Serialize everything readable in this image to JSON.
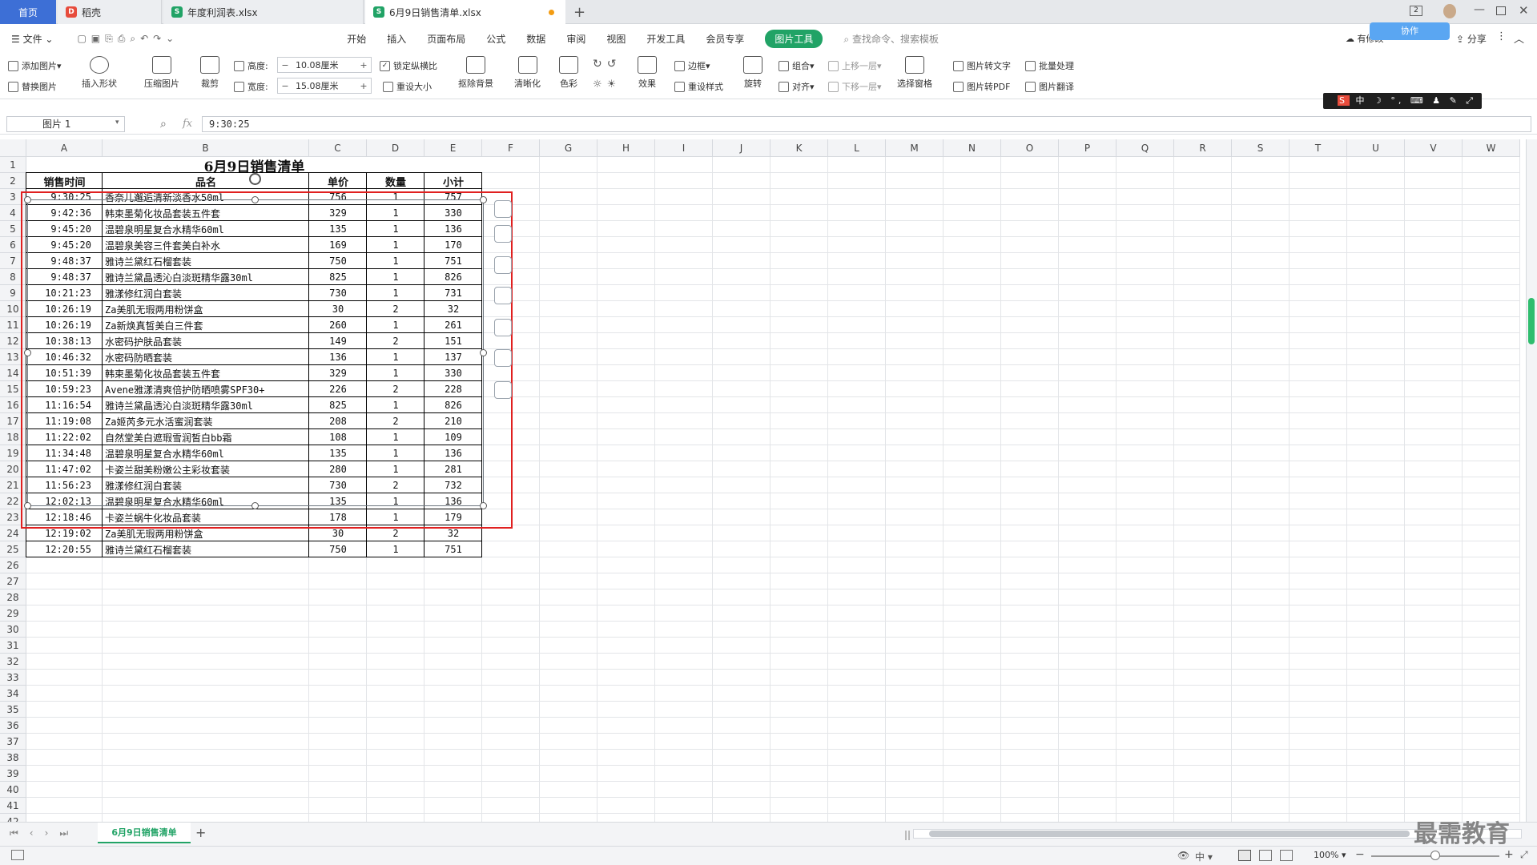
{
  "tabs": [
    {
      "label": "首页"
    },
    {
      "label": "稻壳"
    },
    {
      "label": "年度利润表.xlsx"
    },
    {
      "label": "6月9日销售清单.xlsx"
    }
  ],
  "menu": {
    "file": "文件",
    "items": [
      "开始",
      "插入",
      "页面布局",
      "公式",
      "数据",
      "审阅",
      "视图",
      "开发工具",
      "会员专享",
      "图片工具"
    ],
    "search": "查找命令、搜索模板",
    "share": "分享",
    "collab": "协作",
    "sync": "有修改"
  },
  "ribbon": {
    "add_image": "添加图片",
    "replace_image": "替换图片",
    "insert_shape": "插入形状",
    "compress": "压缩图片",
    "crop": "裁剪",
    "height_label": "高度:",
    "height_value": "10.08厘米",
    "width_label": "宽度:",
    "width_value": "15.08厘米",
    "lock_ratio": "锁定纵横比",
    "reset_size": "重设大小",
    "remove_bg": "抠除背景",
    "sharpen": "清晰化",
    "color": "色彩",
    "effect": "效果",
    "border": "边框",
    "reset_style": "重设样式",
    "rotate": "旋转",
    "group": "组合",
    "align": "对齐",
    "bring_forward": "上移一层",
    "send_backward": "下移一层",
    "selection_pane": "选择窗格",
    "to_text": "图片转文字",
    "to_pdf": "图片转PDF",
    "batch": "批量处理",
    "translate": "图片翻译"
  },
  "formula_bar": {
    "name": "图片 1",
    "value": "9:30:25"
  },
  "columns": [
    "A",
    "B",
    "C",
    "D",
    "E",
    "F",
    "G",
    "H",
    "I",
    "J",
    "K",
    "L",
    "M",
    "N",
    "O",
    "P",
    "Q",
    "R",
    "S",
    "T",
    "U",
    "V",
    "W"
  ],
  "row_count": 43,
  "sheet": {
    "title": "6月9日销售清单",
    "headers": [
      "销售时间",
      "品名",
      "单价",
      "数量",
      "小计"
    ],
    "rows": [
      [
        "9:30:25",
        "香奈儿邂逅清新淡香水50ml",
        "756",
        "1",
        "757"
      ],
      [
        "9:42:36",
        "韩束墨菊化妆品套装五件套",
        "329",
        "1",
        "330"
      ],
      [
        "9:45:20",
        "温碧泉明星复合水精华60ml",
        "135",
        "1",
        "136"
      ],
      [
        "9:45:20",
        "温碧泉美容三件套美白补水",
        "169",
        "1",
        "170"
      ],
      [
        "9:48:37",
        "雅诗兰黛红石榴套装",
        "750",
        "1",
        "751"
      ],
      [
        "9:48:37",
        "雅诗兰黛晶透沁白淡斑精华露30ml",
        "825",
        "1",
        "826"
      ],
      [
        "10:21:23",
        "雅漾修红润白套装",
        "730",
        "1",
        "731"
      ],
      [
        "10:26:19",
        "Za美肌无瑕两用粉饼盒",
        "30",
        "2",
        "32"
      ],
      [
        "10:26:19",
        "Za新焕真皙美白三件套",
        "260",
        "1",
        "261"
      ],
      [
        "10:38:13",
        "水密码护肤品套装",
        "149",
        "2",
        "151"
      ],
      [
        "10:46:32",
        "水密码防晒套装",
        "136",
        "1",
        "137"
      ],
      [
        "10:51:39",
        "韩束墨菊化妆品套装五件套",
        "329",
        "1",
        "330"
      ],
      [
        "10:59:23",
        "Avene雅漾清爽倍护防晒喷雾SPF30+",
        "226",
        "2",
        "228"
      ],
      [
        "11:16:54",
        "雅诗兰黛晶透沁白淡斑精华露30ml",
        "825",
        "1",
        "826"
      ],
      [
        "11:19:08",
        "Za姬芮多元水活蜜润套装",
        "208",
        "2",
        "210"
      ],
      [
        "11:22:02",
        "自然堂美白遮瑕雪润皙白bb霜",
        "108",
        "1",
        "109"
      ],
      [
        "11:34:48",
        "温碧泉明星复合水精华60ml",
        "135",
        "1",
        "136"
      ],
      [
        "11:47:02",
        "卡姿兰甜美粉嫩公主彩妆套装",
        "280",
        "1",
        "281"
      ],
      [
        "11:56:23",
        "雅漾修红润白套装",
        "730",
        "2",
        "732"
      ],
      [
        "12:02:13",
        "温碧泉明星复合水精华60ml",
        "135",
        "1",
        "136"
      ],
      [
        "12:18:46",
        "卡姿兰蜗牛化妆品套装",
        "178",
        "1",
        "179"
      ],
      [
        "12:19:02",
        "Za美肌无瑕两用粉饼盒",
        "30",
        "2",
        "32"
      ],
      [
        "12:20:55",
        "雅诗兰黛红石榴套装",
        "750",
        "1",
        "751"
      ]
    ]
  },
  "sheet_tab": "6月9日销售清单",
  "status": {
    "zoom": "100%",
    "ime": "中"
  },
  "watermark": "最需教育"
}
